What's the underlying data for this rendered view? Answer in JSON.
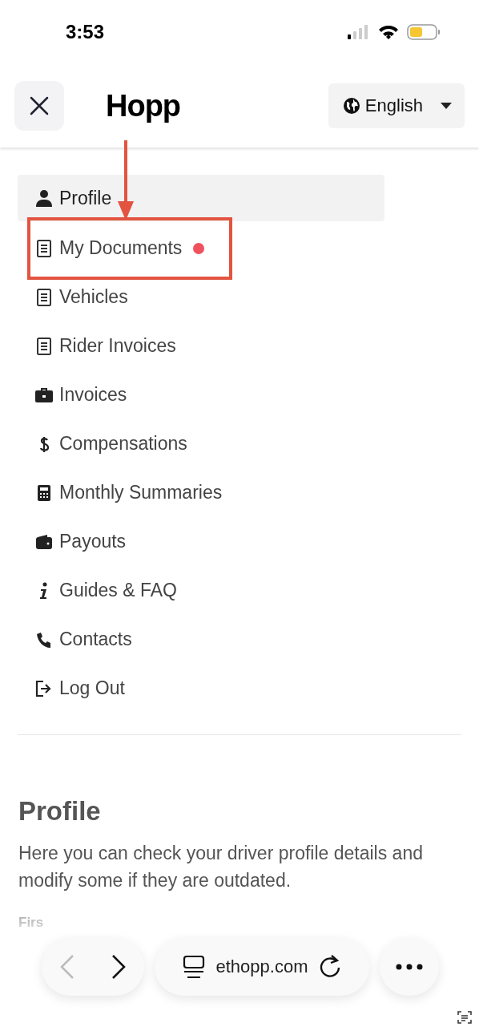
{
  "status_bar": {
    "time": "3:53"
  },
  "header": {
    "logo": "Hopp",
    "language": "English"
  },
  "menu": [
    {
      "label": "Profile",
      "kind": "person",
      "selected": true,
      "notification": false,
      "highlighted": false
    },
    {
      "label": "My Documents",
      "kind": "document",
      "selected": false,
      "notification": true,
      "highlighted": true
    },
    {
      "label": "Vehicles",
      "kind": "document",
      "selected": false,
      "notification": false,
      "highlighted": false
    },
    {
      "label": "Rider Invoices",
      "kind": "document",
      "selected": false,
      "notification": false,
      "highlighted": false
    },
    {
      "label": "Invoices",
      "kind": "briefcase",
      "selected": false,
      "notification": false,
      "highlighted": false
    },
    {
      "label": "Compensations",
      "kind": "dollar",
      "selected": false,
      "notification": false,
      "highlighted": false
    },
    {
      "label": "Monthly Summaries",
      "kind": "calculator",
      "selected": false,
      "notification": false,
      "highlighted": false
    },
    {
      "label": "Payouts",
      "kind": "wallet",
      "selected": false,
      "notification": false,
      "highlighted": false
    },
    {
      "label": "Guides & FAQ",
      "kind": "info",
      "selected": false,
      "notification": false,
      "highlighted": false
    },
    {
      "label": "Contacts",
      "kind": "phone",
      "selected": false,
      "notification": false,
      "highlighted": false
    },
    {
      "label": "Log Out",
      "kind": "logout",
      "selected": false,
      "notification": false,
      "highlighted": false
    }
  ],
  "section": {
    "title": "Profile",
    "description": "Here you can check your driver profile details and modify some if they are outdated.",
    "field_label": "Firs"
  },
  "browser_bar": {
    "url": "ethopp.com"
  }
}
